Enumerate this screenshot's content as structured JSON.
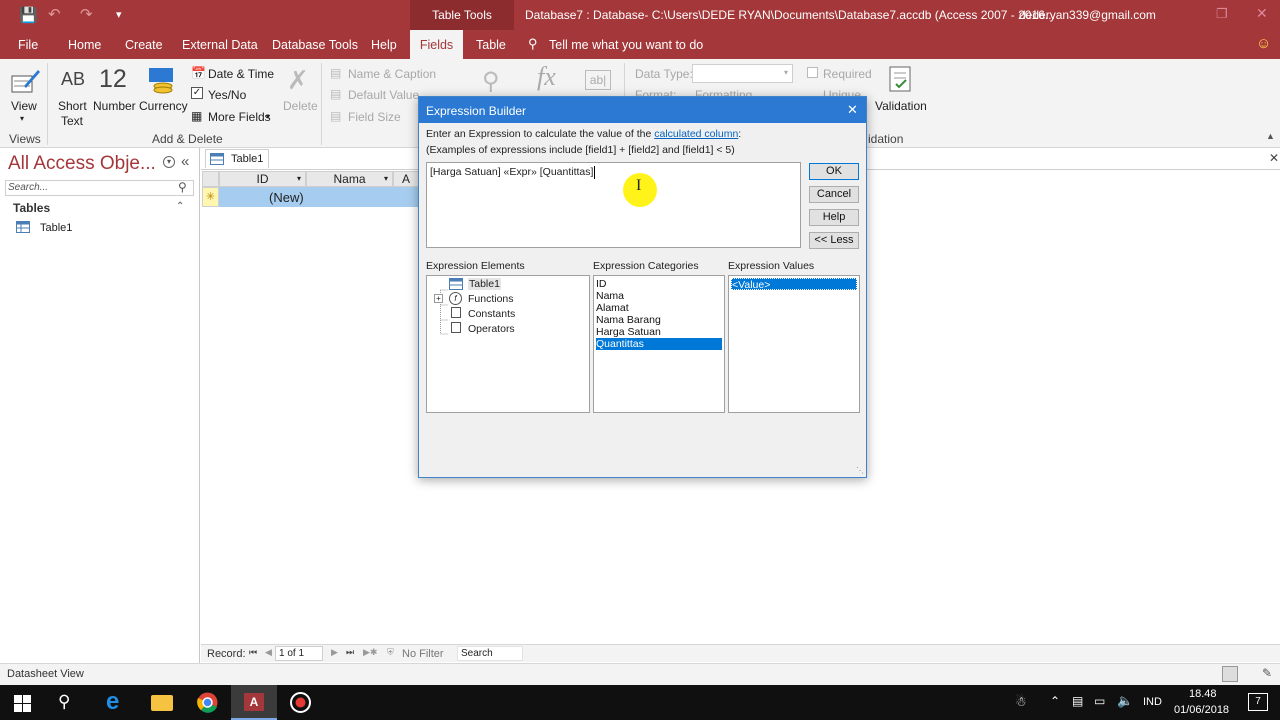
{
  "titlebar": {
    "context_tab": "Table Tools",
    "title": "Database7 : Database- C:\\Users\\DEDE RYAN\\Documents\\Database7.accdb (Access 2007 - 2016...",
    "account": "dederyan339@gmail.com"
  },
  "tabs": [
    "File",
    "Home",
    "Create",
    "External Data",
    "Database Tools",
    "Help",
    "Fields",
    "Table"
  ],
  "tell_me": "Tell me what you want to do",
  "ribbon": {
    "view": "View",
    "short_text_glyph": "AB",
    "short_text": "Short Text",
    "number_glyph": "12",
    "number": "Number",
    "currency": "Currency",
    "date_time": "Date & Time",
    "yes_no": "Yes/No",
    "more_fields": "More Fields",
    "delete": "Delete",
    "name_caption": "Name & Caption",
    "default_value": "Default Value",
    "field_size": "Field Size",
    "data_type": "Data Type:",
    "format": "Format:",
    "formatting": "Formatting",
    "required": "Required",
    "unique": "Unique",
    "validation": "Validation",
    "group_views": "Views",
    "group_add_delete": "Add & Delete",
    "group_validation": "idation"
  },
  "nav": {
    "title": "All Access Obje...",
    "search_placeholder": "Search...",
    "section": "Tables",
    "item": "Table1"
  },
  "datasheet": {
    "tab": "Table1",
    "col_id": "ID",
    "col_nama": "Nama",
    "col_a": "A",
    "new_row": "(New)"
  },
  "record_nav": {
    "label": "Record:",
    "position": "1 of 1",
    "filter": "No Filter",
    "search": "Search"
  },
  "status": "Datasheet View",
  "dialog": {
    "title": "Expression Builder",
    "instr_prefix": "Enter an Expression to calculate the value of the ",
    "instr_link": "calculated column",
    "instr_suffix": ":",
    "example": "(Examples of expressions include [field1] + [field2] and [field1] < 5)",
    "expression": "[Harga Satuan] «Expr» [Quantittas]",
    "ok": "OK",
    "cancel": "Cancel",
    "help": "Help",
    "less": "<< Less",
    "elements_label": "Expression Elements",
    "categories_label": "Expression Categories",
    "values_label": "Expression Values",
    "elements": [
      "Table1",
      "Functions",
      "Constants",
      "Operators"
    ],
    "categories": [
      "ID",
      "Nama",
      "Alamat",
      "Nama Barang",
      "Harga Satuan",
      "Quantittas"
    ],
    "values": [
      "<Value>"
    ]
  },
  "taskbar": {
    "lang": "IND",
    "time": "18.48",
    "date": "01/06/2018",
    "notif": "7"
  },
  "colors": {
    "accent": "#a4373a",
    "selection": "#0078d7",
    "dialog_title": "#2b79d2",
    "highlight_cursor": "#fff200"
  }
}
